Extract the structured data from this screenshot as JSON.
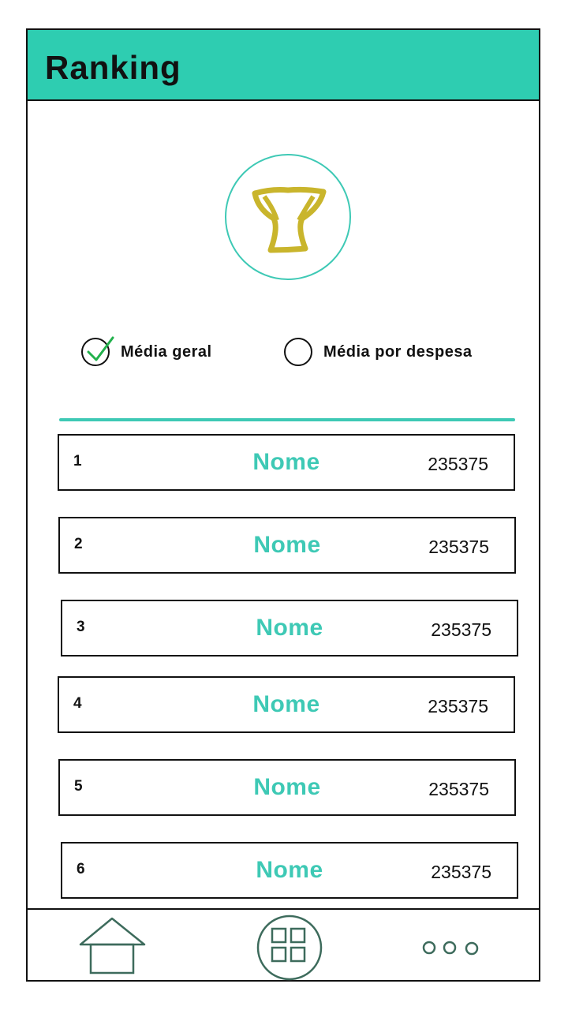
{
  "header": {
    "title": "Ranking"
  },
  "filters": [
    {
      "label": "Média geral",
      "selected": true
    },
    {
      "label": "Média por despesa",
      "selected": false
    }
  ],
  "ranking": [
    {
      "position": "1",
      "name": "Nome",
      "score": "235375"
    },
    {
      "position": "2",
      "name": "Nome",
      "score": "235375"
    },
    {
      "position": "3",
      "name": "Nome",
      "score": "235375"
    },
    {
      "position": "4",
      "name": "Nome",
      "score": "235375"
    },
    {
      "position": "5",
      "name": "Nome",
      "score": "235375"
    },
    {
      "position": "6",
      "name": "Nome",
      "score": "235375"
    }
  ],
  "nav": {
    "items": [
      "home-icon",
      "grid-icon",
      "more-icon"
    ]
  },
  "colors": {
    "accent": "#2ecdb1",
    "trophy": "#c9b52c",
    "check": "#22b14c",
    "nav_icon": "#3d6b5c"
  }
}
